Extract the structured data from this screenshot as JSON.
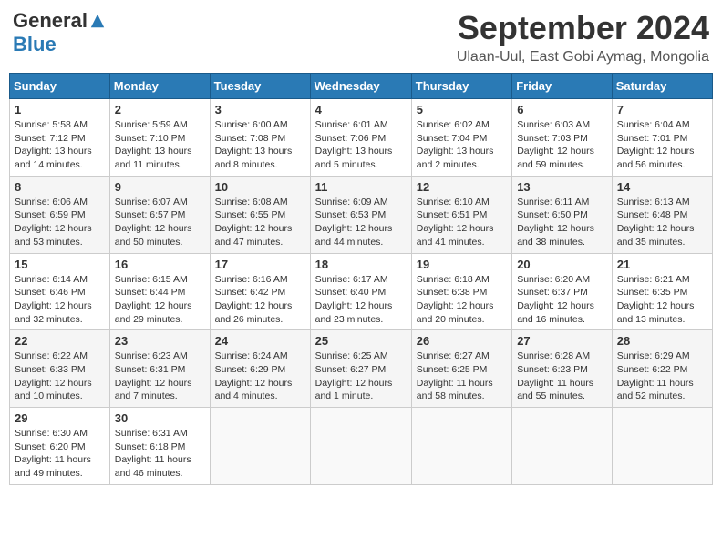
{
  "logo": {
    "general": "General",
    "blue": "Blue"
  },
  "title": {
    "month": "September 2024",
    "location": "Ulaan-Uul, East Gobi Aymag, Mongolia"
  },
  "headers": [
    "Sunday",
    "Monday",
    "Tuesday",
    "Wednesday",
    "Thursday",
    "Friday",
    "Saturday"
  ],
  "weeks": [
    [
      {
        "day": "1",
        "sunrise": "5:58 AM",
        "sunset": "7:12 PM",
        "daylight": "13 hours and 14 minutes."
      },
      {
        "day": "2",
        "sunrise": "5:59 AM",
        "sunset": "7:10 PM",
        "daylight": "13 hours and 11 minutes."
      },
      {
        "day": "3",
        "sunrise": "6:00 AM",
        "sunset": "7:08 PM",
        "daylight": "13 hours and 8 minutes."
      },
      {
        "day": "4",
        "sunrise": "6:01 AM",
        "sunset": "7:06 PM",
        "daylight": "13 hours and 5 minutes."
      },
      {
        "day": "5",
        "sunrise": "6:02 AM",
        "sunset": "7:04 PM",
        "daylight": "13 hours and 2 minutes."
      },
      {
        "day": "6",
        "sunrise": "6:03 AM",
        "sunset": "7:03 PM",
        "daylight": "12 hours and 59 minutes."
      },
      {
        "day": "7",
        "sunrise": "6:04 AM",
        "sunset": "7:01 PM",
        "daylight": "12 hours and 56 minutes."
      }
    ],
    [
      {
        "day": "8",
        "sunrise": "6:06 AM",
        "sunset": "6:59 PM",
        "daylight": "12 hours and 53 minutes."
      },
      {
        "day": "9",
        "sunrise": "6:07 AM",
        "sunset": "6:57 PM",
        "daylight": "12 hours and 50 minutes."
      },
      {
        "day": "10",
        "sunrise": "6:08 AM",
        "sunset": "6:55 PM",
        "daylight": "12 hours and 47 minutes."
      },
      {
        "day": "11",
        "sunrise": "6:09 AM",
        "sunset": "6:53 PM",
        "daylight": "12 hours and 44 minutes."
      },
      {
        "day": "12",
        "sunrise": "6:10 AM",
        "sunset": "6:51 PM",
        "daylight": "12 hours and 41 minutes."
      },
      {
        "day": "13",
        "sunrise": "6:11 AM",
        "sunset": "6:50 PM",
        "daylight": "12 hours and 38 minutes."
      },
      {
        "day": "14",
        "sunrise": "6:13 AM",
        "sunset": "6:48 PM",
        "daylight": "12 hours and 35 minutes."
      }
    ],
    [
      {
        "day": "15",
        "sunrise": "6:14 AM",
        "sunset": "6:46 PM",
        "daylight": "12 hours and 32 minutes."
      },
      {
        "day": "16",
        "sunrise": "6:15 AM",
        "sunset": "6:44 PM",
        "daylight": "12 hours and 29 minutes."
      },
      {
        "day": "17",
        "sunrise": "6:16 AM",
        "sunset": "6:42 PM",
        "daylight": "12 hours and 26 minutes."
      },
      {
        "day": "18",
        "sunrise": "6:17 AM",
        "sunset": "6:40 PM",
        "daylight": "12 hours and 23 minutes."
      },
      {
        "day": "19",
        "sunrise": "6:18 AM",
        "sunset": "6:38 PM",
        "daylight": "12 hours and 20 minutes."
      },
      {
        "day": "20",
        "sunrise": "6:20 AM",
        "sunset": "6:37 PM",
        "daylight": "12 hours and 16 minutes."
      },
      {
        "day": "21",
        "sunrise": "6:21 AM",
        "sunset": "6:35 PM",
        "daylight": "12 hours and 13 minutes."
      }
    ],
    [
      {
        "day": "22",
        "sunrise": "6:22 AM",
        "sunset": "6:33 PM",
        "daylight": "12 hours and 10 minutes."
      },
      {
        "day": "23",
        "sunrise": "6:23 AM",
        "sunset": "6:31 PM",
        "daylight": "12 hours and 7 minutes."
      },
      {
        "day": "24",
        "sunrise": "6:24 AM",
        "sunset": "6:29 PM",
        "daylight": "12 hours and 4 minutes."
      },
      {
        "day": "25",
        "sunrise": "6:25 AM",
        "sunset": "6:27 PM",
        "daylight": "12 hours and 1 minute."
      },
      {
        "day": "26",
        "sunrise": "6:27 AM",
        "sunset": "6:25 PM",
        "daylight": "11 hours and 58 minutes."
      },
      {
        "day": "27",
        "sunrise": "6:28 AM",
        "sunset": "6:23 PM",
        "daylight": "11 hours and 55 minutes."
      },
      {
        "day": "28",
        "sunrise": "6:29 AM",
        "sunset": "6:22 PM",
        "daylight": "11 hours and 52 minutes."
      }
    ],
    [
      {
        "day": "29",
        "sunrise": "6:30 AM",
        "sunset": "6:20 PM",
        "daylight": "11 hours and 49 minutes."
      },
      {
        "day": "30",
        "sunrise": "6:31 AM",
        "sunset": "6:18 PM",
        "daylight": "11 hours and 46 minutes."
      },
      null,
      null,
      null,
      null,
      null
    ]
  ]
}
